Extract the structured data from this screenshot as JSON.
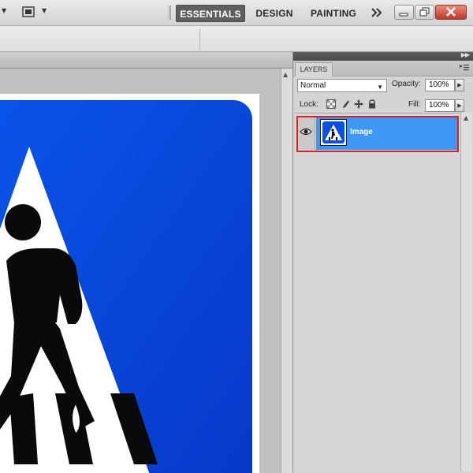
{
  "appbar": {
    "workspaces": [
      "ESSENTIALS",
      "DESIGN",
      "PAINTING"
    ],
    "active_workspace": "ESSENTIALS",
    "icons": [
      "dropdown-arrow-icon",
      "screen-mode-icon",
      "more-workspaces-icon",
      "minimize-icon",
      "restore-icon",
      "close-icon"
    ]
  },
  "layers_panel": {
    "tab": "LAYERS",
    "blend_mode": "Normal",
    "opacity_label": "Opacity:",
    "opacity_value": "100%",
    "lock_label": "Lock:",
    "fill_label": "Fill:",
    "fill_value": "100%",
    "lock_icons": [
      "lock-transparent-pixels-icon",
      "lock-image-pixels-icon",
      "lock-position-icon",
      "lock-all-icon"
    ],
    "layers": [
      {
        "name": "Image",
        "visible": true,
        "selected": true
      }
    ],
    "highlight_color": "#d8202a",
    "selection_color": "#3c98f4"
  },
  "canvas": {
    "image": "pedestrian-crossing-sign",
    "sign_color": "#0a4fe0"
  }
}
